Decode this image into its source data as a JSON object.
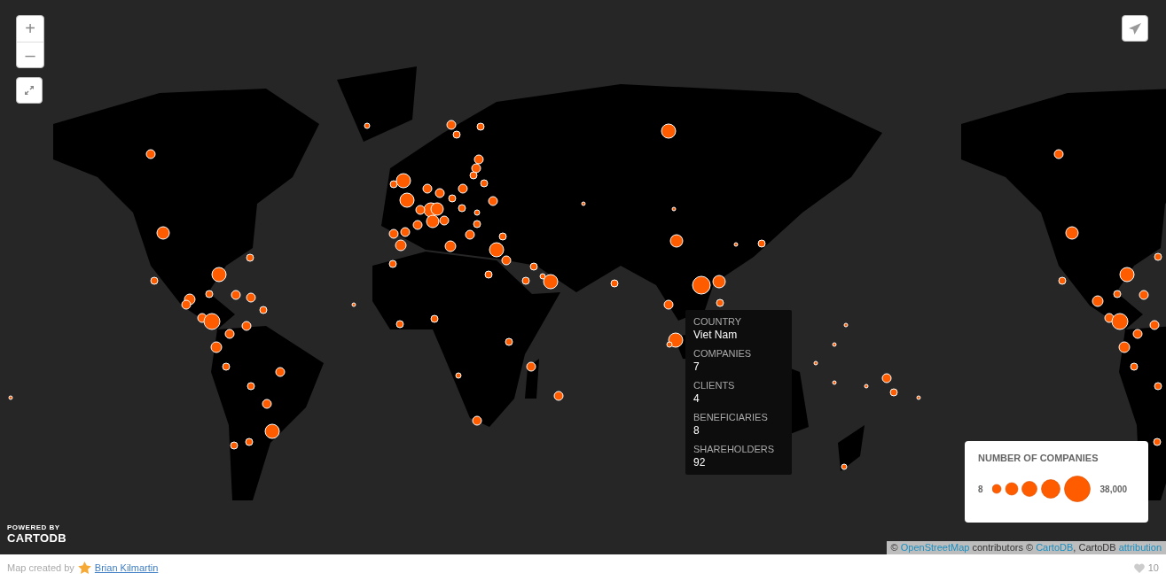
{
  "map_controls": {
    "zoom_in": "+",
    "zoom_out": "–"
  },
  "tooltip": {
    "fields": [
      {
        "label": "COUNTRY",
        "value": "Viet Nam"
      },
      {
        "label": "COMPANIES",
        "value": "7"
      },
      {
        "label": "CLIENTS",
        "value": "4"
      },
      {
        "label": "BENEFICIARIES",
        "value": "8"
      },
      {
        "label": "SHAREHOLDERS",
        "value": "92"
      }
    ]
  },
  "legend": {
    "title": "NUMBER OF COMPANIES",
    "min": "8",
    "max": "38,000"
  },
  "logo": {
    "tagline": "POWERED BY",
    "name": "CARTODB"
  },
  "attribution": [
    {
      "kind": "text",
      "text": "© "
    },
    {
      "kind": "link",
      "text": "OpenStreetMap"
    },
    {
      "kind": "text",
      "text": " contributors © "
    },
    {
      "kind": "link",
      "text": "CartoDB"
    },
    {
      "kind": "text",
      "text": ", CartoDB "
    },
    {
      "kind": "link",
      "text": "attribution"
    }
  ],
  "footer": {
    "credit": "Map created by",
    "author": "Brian Kilmartin",
    "likes": "10"
  }
}
